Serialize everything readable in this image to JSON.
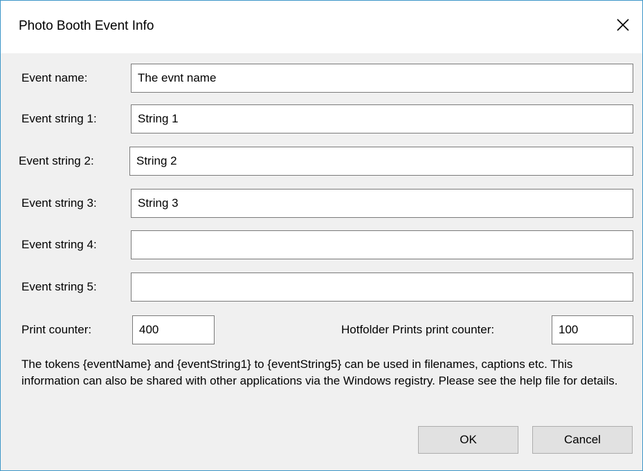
{
  "window": {
    "title": "Photo Booth Event Info",
    "close_icon": "close-x-icon"
  },
  "form": {
    "event_name": {
      "label": "Event name:",
      "value": "The evnt name"
    },
    "event_string_1": {
      "label": "Event string 1:",
      "value": "String 1"
    },
    "event_string_2": {
      "label": "Event string 2:",
      "value": "String 2"
    },
    "event_string_3": {
      "label": "Event string 3:",
      "value": "String 3"
    },
    "event_string_4": {
      "label": "Event string 4:",
      "value": ""
    },
    "event_string_5": {
      "label": "Event string 5:",
      "value": ""
    },
    "print_counter": {
      "label": "Print counter:",
      "value": "400"
    },
    "hotfolder_print_counter": {
      "label": "Hotfolder Prints print counter:",
      "value": "100"
    }
  },
  "info": {
    "text": "The tokens {eventName} and {eventString1} to {eventString5} can be used in filenames, captions etc. This information can also be shared with other applications via the Windows registry. Please see the help file for details."
  },
  "buttons": {
    "ok_label": "OK",
    "cancel_label": "Cancel"
  },
  "colors": {
    "window_border": "#3c96c8",
    "dialog_bg": "#f0f0f0",
    "button_bg": "#e1e1e1"
  }
}
